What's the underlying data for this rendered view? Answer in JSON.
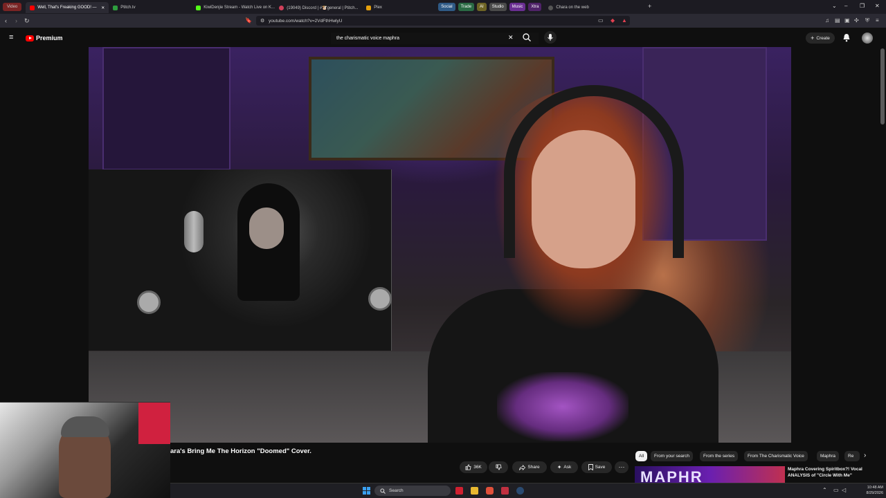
{
  "browser": {
    "tabs": [
      {
        "label": "Video",
        "color": "#b83a3a"
      },
      {
        "label": "Well, That's Freaking GOOD! —",
        "active": true
      },
      {
        "label": "Ptitch.tv"
      },
      {
        "label": "KiwiDenjie Stream - Watch Live on K..."
      },
      {
        "label": "(19049) Discord | #🐮general | Ptitch..."
      },
      {
        "label": "Plex"
      }
    ],
    "groups": [
      {
        "label": "Social",
        "color": "#3a6ea5"
      },
      {
        "label": "Trade",
        "color": "#2e7d4f"
      },
      {
        "label": "AI",
        "color": "#8a7a2a"
      },
      {
        "label": "Studio",
        "color": "#555555"
      },
      {
        "label": "Music",
        "color": "#7a3aa5"
      },
      {
        "label": "Xtra",
        "color": "#6a2a8a"
      }
    ],
    "extra_tab": "Chara on the web",
    "url": "youtube.com/watch?v=2VdFthHwlyU"
  },
  "youtube": {
    "logo_text": "Premium",
    "search_query": "the charismatic voice maphra",
    "create_label": "Create"
  },
  "video": {
    "title": "ara's Bring Me The Horizon \"Doomed\" Cover.",
    "likes": "36K",
    "share_label": "Share",
    "ask_label": "Ask",
    "save_label": "Save"
  },
  "chips": [
    "All",
    "From your search",
    "From the series",
    "From The Charismatic Voice",
    "Maphra",
    "Re"
  ],
  "suggestion": {
    "thumb_text": "MAPHR",
    "title": "Maphra Covering Spiritbox?! Vocal ANALYSIS of \"Circle With Me\""
  },
  "taskbar": {
    "search_label": "Search",
    "time": "10:48 AM",
    "date": "8/29/2026"
  }
}
